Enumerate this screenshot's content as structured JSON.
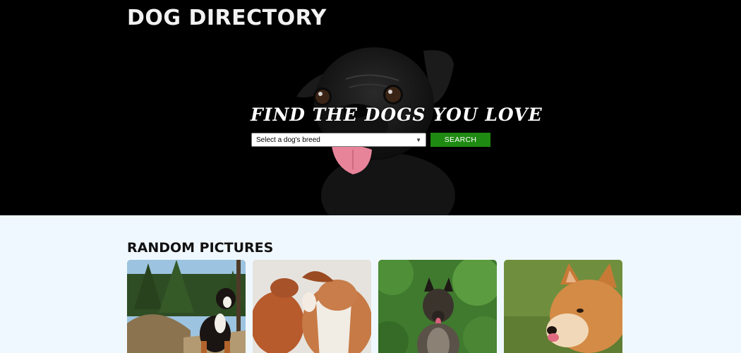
{
  "header": {
    "site_title": "DOG DIRECTORY"
  },
  "hero": {
    "tagline": "FIND THE DOGS YOU LOVE",
    "search": {
      "select_value": "Select a dog's breed",
      "button_label": "SEARCH"
    }
  },
  "random_pictures": {
    "title": "RANDOM PICTURES",
    "images": [
      {
        "icon": "bernese-mountain-dog-photo"
      },
      {
        "icon": "hound-puppies-photo"
      },
      {
        "icon": "belgian-shepherd-photo"
      },
      {
        "icon": "shiba-inu-photo"
      }
    ]
  },
  "colors": {
    "hero_background": "#000000",
    "page_background": "#f0f8ff",
    "search_button": "#1f8a12"
  }
}
